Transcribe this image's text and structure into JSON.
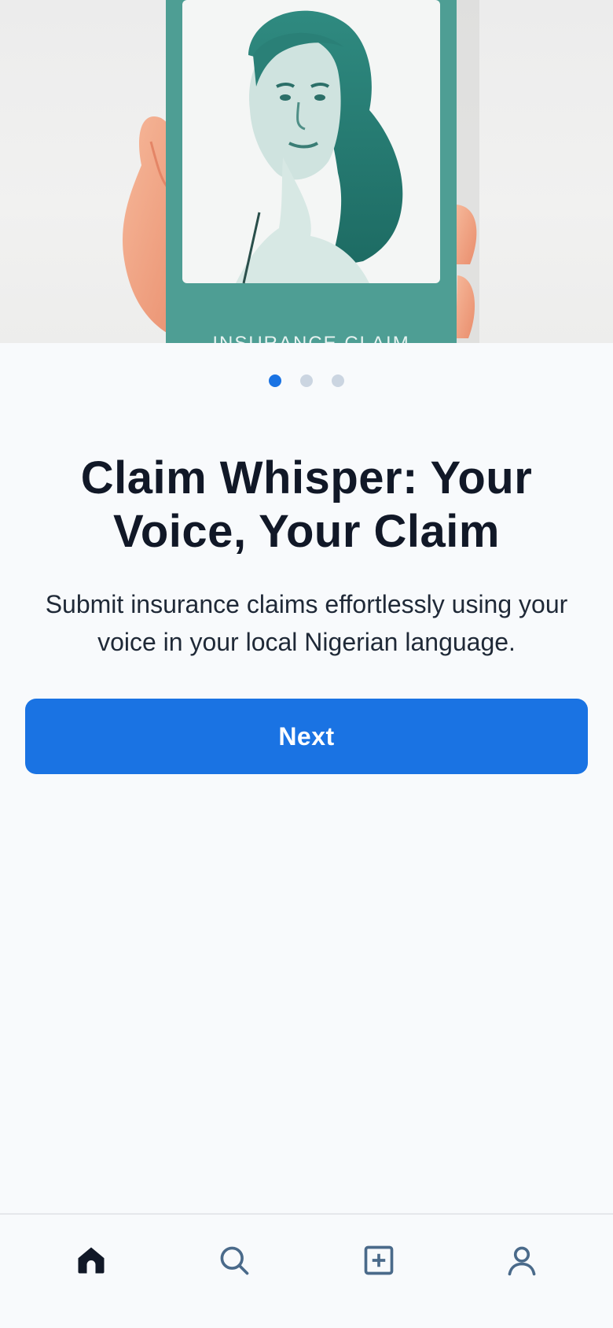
{
  "hero": {
    "card_caption": "INSURANCE CLAIM"
  },
  "pager": {
    "count": 3,
    "active_index": 0
  },
  "content": {
    "title": "Claim Whisper: Your Voice, Your Claim",
    "subtitle": "Submit insurance claims effortlessly using your voice in your local Nigerian language."
  },
  "actions": {
    "next_label": "Next"
  },
  "bottom_nav": {
    "items": [
      {
        "icon": "home-icon",
        "active": true
      },
      {
        "icon": "search-icon",
        "active": false
      },
      {
        "icon": "add-square-icon",
        "active": false
      },
      {
        "icon": "profile-icon",
        "active": false
      }
    ]
  },
  "colors": {
    "accent": "#1a73e3",
    "dot_inactive": "#cbd5e1",
    "text_primary": "#111827",
    "nav_active": "#111827",
    "nav_inactive": "#4a6a8a",
    "card_teal": "#4e9e94"
  }
}
